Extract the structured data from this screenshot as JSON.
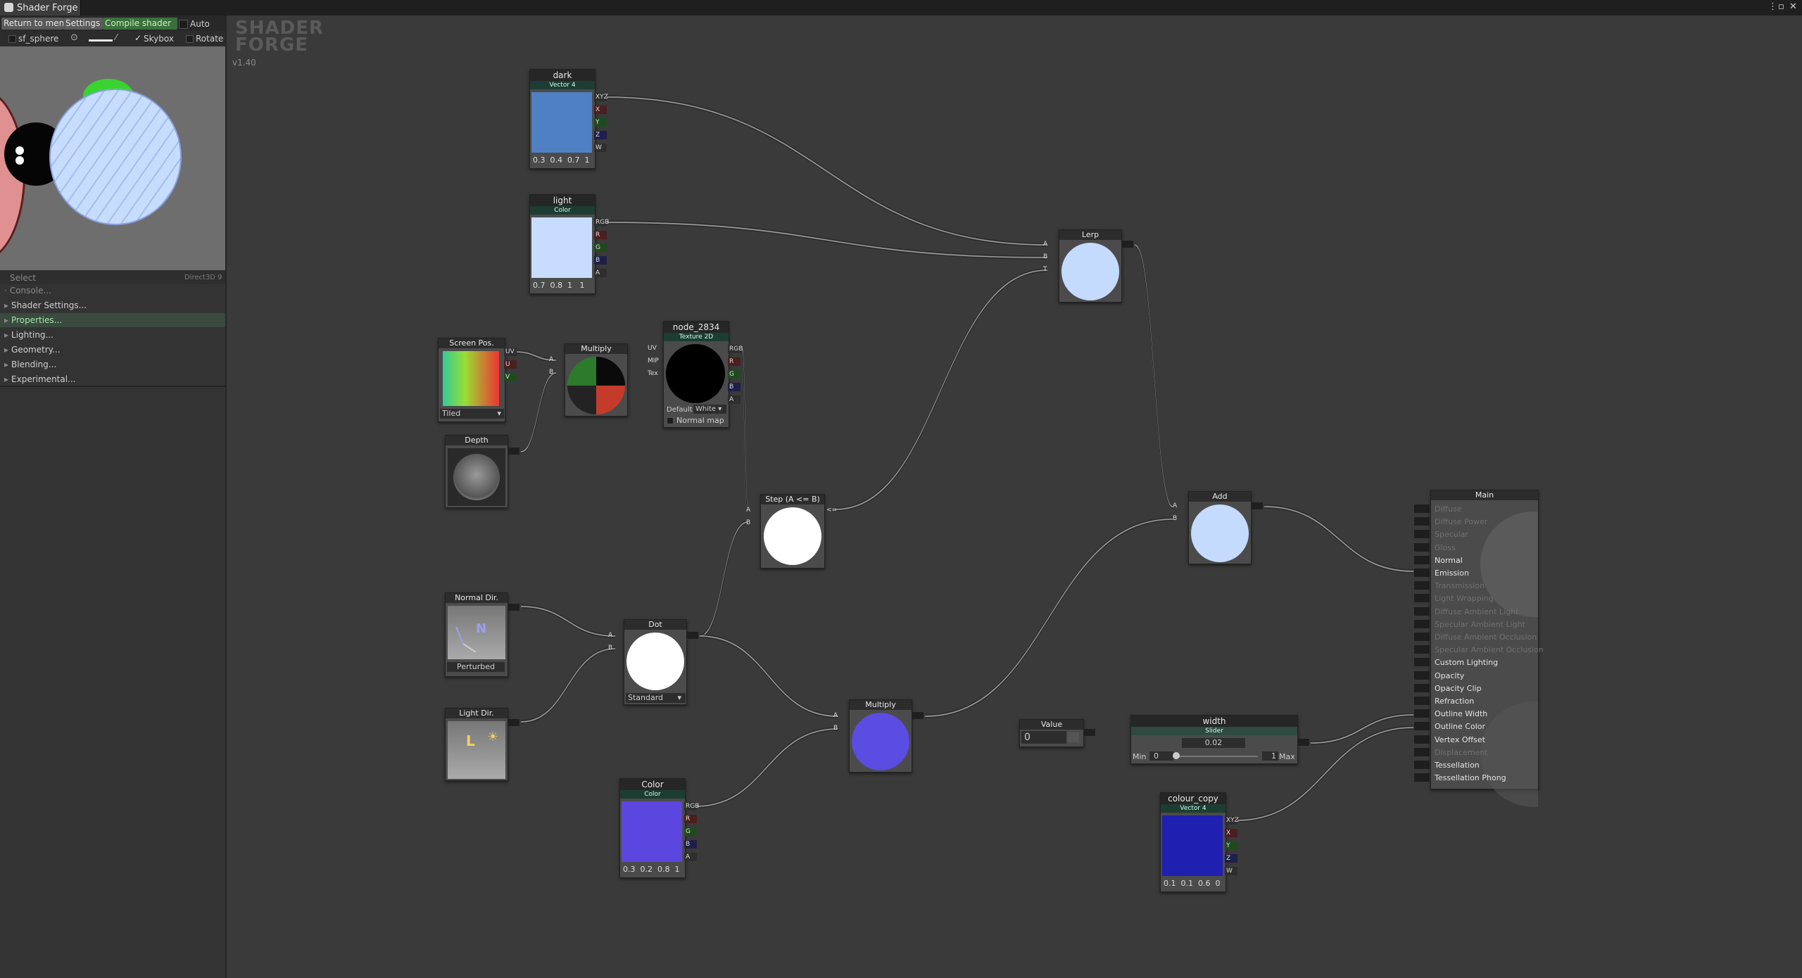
{
  "window": {
    "title": "Shader Forge"
  },
  "toolbar": {
    "return_label": "Return to menu",
    "settings_label": "Settings",
    "compile_label": "Compile shader",
    "auto_label": "Auto",
    "mesh_label": "sf_sphere",
    "skybox_label": "Skybox",
    "rotate_label": "Rotate"
  },
  "left_panel": {
    "select_label": "Select",
    "renderer_label": "Direct3D 9",
    "menu_items": [
      "Console...",
      "Shader Settings...",
      "Properties...",
      "Lighting...",
      "Geometry...",
      "Blending...",
      "Experimental..."
    ]
  },
  "logo": {
    "line1": "SHADER",
    "line2": "FORGE",
    "version": "v1.40"
  },
  "nodes": {
    "dark": {
      "title": "dark",
      "subtitle": "Vector 4",
      "ports": [
        "XYZ",
        "X",
        "Y",
        "Z",
        "W"
      ],
      "values": [
        "0.3",
        "0.4",
        "0.7",
        "1"
      ],
      "color": "#4f80c4"
    },
    "light": {
      "title": "light",
      "subtitle": "Color",
      "ports": [
        "RGB",
        "R",
        "G",
        "B",
        "A"
      ],
      "values": [
        "0.7",
        "0.8",
        "1",
        "1"
      ],
      "color": "#c7dcfe"
    },
    "lerp": {
      "title": "Lerp",
      "inputs": [
        "A",
        "B",
        "T"
      ],
      "color": "#c4dbfd"
    },
    "screen_pos": {
      "title": "Screen Pos.",
      "ports": [
        "UV",
        "U",
        "V"
      ],
      "mode": "Tiled"
    },
    "multiply1": {
      "title": "Multiply",
      "inputs": [
        "A",
        "B"
      ]
    },
    "texture": {
      "title": "node_2834",
      "subtitle": "Texture 2D",
      "inputs": [
        "UV",
        "MIP",
        "Tex"
      ],
      "ports": [
        "RGB",
        "R",
        "G",
        "B",
        "A"
      ],
      "default_label": "Default",
      "default_value": "White",
      "normal_map_label": "Normal map"
    },
    "depth": {
      "title": "Depth"
    },
    "step": {
      "title": "Step (A <= B)",
      "inputs": [
        "A",
        "B"
      ],
      "out_label": "<="
    },
    "add": {
      "title": "Add",
      "inputs": [
        "A",
        "B"
      ],
      "color": "#c4dbfd"
    },
    "normal_dir": {
      "title": "Normal Dir.",
      "mode": "Perturbed",
      "glyph": "N"
    },
    "dot": {
      "title": "Dot",
      "inputs": [
        "A",
        "B"
      ],
      "mode": "Standard"
    },
    "light_dir": {
      "title": "Light Dir.",
      "glyph": "L"
    },
    "multiply2": {
      "title": "Multiply",
      "inputs": [
        "A",
        "B"
      ],
      "color": "#5b4ce2"
    },
    "color": {
      "title": "Color",
      "subtitle": "Color",
      "ports": [
        "RGB",
        "R",
        "G",
        "B",
        "A"
      ],
      "values": [
        "0.3",
        "0.2",
        "0.8",
        "1"
      ],
      "color": "#5b46e0"
    },
    "value": {
      "title": "Value",
      "value": "0"
    },
    "width": {
      "title": "width",
      "subtitle": "Slider",
      "value": "0.02",
      "min_label": "Min",
      "min": "0",
      "max": "1",
      "max_label": "Max",
      "fraction": 0.02
    },
    "colour_copy": {
      "title": "colour_copy",
      "subtitle": "Vector 4",
      "ports": [
        "XYZ",
        "X",
        "Y",
        "Z",
        "W"
      ],
      "values": [
        "0.1",
        "0.1",
        "0.6",
        "0"
      ],
      "color": "#1f1fb0"
    },
    "main": {
      "title": "Main",
      "inputs": [
        {
          "label": "Diffuse",
          "active": false
        },
        {
          "label": "Diffuse Power",
          "active": false
        },
        {
          "label": "Specular",
          "active": false
        },
        {
          "label": "Gloss",
          "active": false
        },
        {
          "label": "Normal",
          "active": true
        },
        {
          "label": "Emission",
          "active": true
        },
        {
          "label": "Transmission",
          "active": false
        },
        {
          "label": "Light Wrapping",
          "active": false
        },
        {
          "label": "Diffuse Ambient Light",
          "active": false
        },
        {
          "label": "Specular Ambient Light",
          "active": false
        },
        {
          "label": "Diffuse Ambient Occlusion",
          "active": false
        },
        {
          "label": "Specular Ambient Occlusion",
          "active": false
        },
        {
          "label": "Custom Lighting",
          "active": true
        },
        {
          "label": "Opacity",
          "active": true
        },
        {
          "label": "Opacity Clip",
          "active": true
        },
        {
          "label": "Refraction",
          "active": true
        },
        {
          "label": "Outline Width",
          "active": true
        },
        {
          "label": "Outline Color",
          "active": true
        },
        {
          "label": "Vertex Offset",
          "active": true
        },
        {
          "label": "Displacement",
          "active": false
        },
        {
          "label": "Tessellation",
          "active": true
        },
        {
          "label": "Tessellation Phong",
          "active": true
        }
      ]
    }
  },
  "colors": {
    "canvas": "#3a3a3a",
    "node_body": "#4b4b4b",
    "accent_green": "#3d6e3d"
  }
}
